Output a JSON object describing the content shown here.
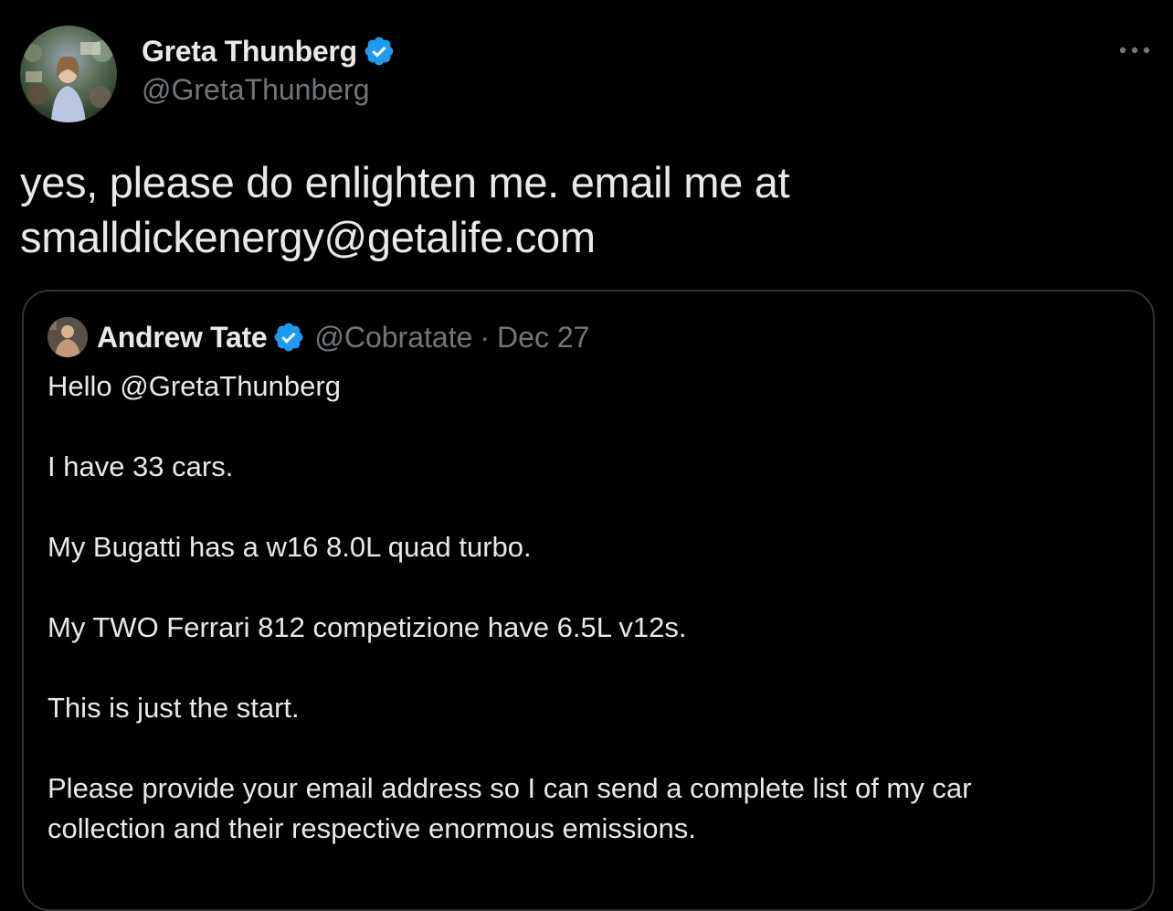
{
  "author": {
    "name": "Greta Thunberg",
    "handle": "@GretaThunberg",
    "verified": true
  },
  "tweet": {
    "lines": [
      "yes, please do enlighten me. email me at",
      "smalldickenergy@getalife.com"
    ]
  },
  "quoted_tweet": {
    "author_name": "Andrew Tate",
    "handle": "@Cobratate",
    "separator": "·",
    "date": "Dec 27",
    "verified": true,
    "paragraphs": [
      [
        "Hello @GretaThunberg"
      ],
      [
        "I have 33 cars."
      ],
      [
        "My Bugatti has a w16 8.0L quad turbo."
      ],
      [
        "My TWO Ferrari 812 competizione have 6.5L v12s."
      ],
      [
        "This is just the start."
      ],
      [
        "Please provide your email address so I can send a complete list of my car",
        "collection and their respective enormous emissions."
      ]
    ]
  },
  "icons": {
    "verified": "verified-badge-icon",
    "more": "more-options-icon"
  },
  "colors": {
    "background": "#000000",
    "text": "#e7e9ea",
    "secondary_text": "#71767b",
    "verified_blue": "#1d9bf0",
    "border": "#2f3336"
  }
}
